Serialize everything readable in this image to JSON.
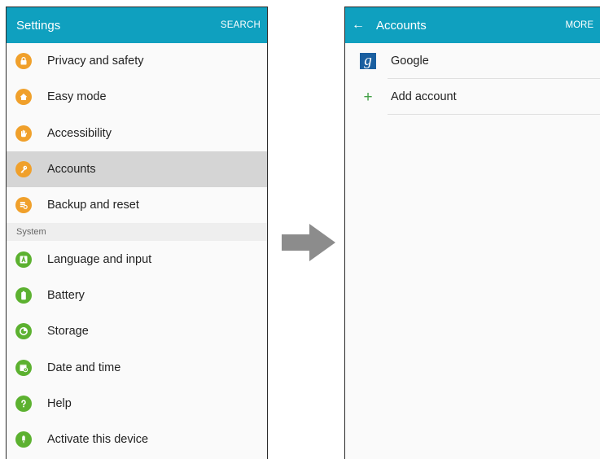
{
  "left_screen": {
    "title": "Settings",
    "search_label": "SEARCH",
    "items_group1": [
      {
        "label": "Privacy and safety",
        "icon": "lock-icon",
        "color": "#f0a02b"
      },
      {
        "label": "Easy mode",
        "icon": "home-icon",
        "color": "#f0a02b"
      },
      {
        "label": "Accessibility",
        "icon": "hand-icon",
        "color": "#f0a02b"
      },
      {
        "label": "Accounts",
        "icon": "key-icon",
        "color": "#f0a02b",
        "selected": true
      },
      {
        "label": "Backup and reset",
        "icon": "backup-icon",
        "color": "#f0a02b"
      }
    ],
    "section_label": "System",
    "items_group2": [
      {
        "label": "Language and input",
        "icon": "keyboard-a-icon",
        "color": "#5cb130"
      },
      {
        "label": "Battery",
        "icon": "battery-icon",
        "color": "#5cb130"
      },
      {
        "label": "Storage",
        "icon": "storage-icon",
        "color": "#5cb130"
      },
      {
        "label": "Date and time",
        "icon": "calendar-clock-icon",
        "color": "#5cb130"
      },
      {
        "label": "Help",
        "icon": "help-icon",
        "color": "#5cb130"
      },
      {
        "label": "Activate this device",
        "icon": "activate-icon",
        "color": "#5cb130"
      }
    ]
  },
  "right_screen": {
    "title": "Accounts",
    "more_label": "MORE",
    "items": [
      {
        "label": "Google",
        "icon": "google-icon"
      },
      {
        "label": "Add account",
        "icon": "plus-icon"
      }
    ],
    "google_glyph": "g",
    "plus_glyph": "+",
    "back_glyph": "←"
  },
  "colors": {
    "app_bar": "#0fa0bf",
    "orange_icon": "#f0a02b",
    "green_icon": "#5cb130",
    "selected_row": "#d5d5d5",
    "arrow": "#8c8c8c"
  }
}
